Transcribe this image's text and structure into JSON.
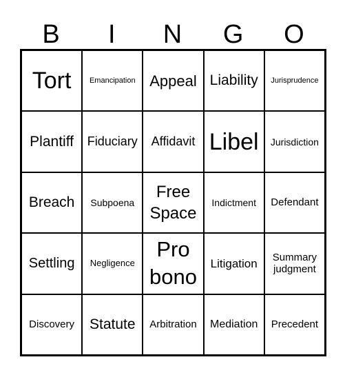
{
  "header": [
    "B",
    "I",
    "N",
    "G",
    "O"
  ],
  "cells": [
    {
      "text": "Tort",
      "size": 34
    },
    {
      "text": "Emancipation",
      "size": 11
    },
    {
      "text": "Appeal",
      "size": 22
    },
    {
      "text": "Liability",
      "size": 21
    },
    {
      "text": "Jurisprudence",
      "size": 11
    },
    {
      "text": "Plantiff",
      "size": 21
    },
    {
      "text": "Fiduciary",
      "size": 18
    },
    {
      "text": "Affidavit",
      "size": 18
    },
    {
      "text": "Libel",
      "size": 34
    },
    {
      "text": "Jurisdiction",
      "size": 14
    },
    {
      "text": "Breach",
      "size": 21
    },
    {
      "text": "Subpoena",
      "size": 14
    },
    {
      "text": "Free Space",
      "size": 24
    },
    {
      "text": "Indictment",
      "size": 14
    },
    {
      "text": "Defendant",
      "size": 15
    },
    {
      "text": "Settling",
      "size": 20
    },
    {
      "text": "Negligence",
      "size": 13
    },
    {
      "text": "Pro bono",
      "size": 31
    },
    {
      "text": "Litigation",
      "size": 17
    },
    {
      "text": "Summary judgment",
      "size": 15
    },
    {
      "text": "Discovery",
      "size": 15
    },
    {
      "text": "Statute",
      "size": 21
    },
    {
      "text": "Arbitration",
      "size": 15
    },
    {
      "text": "Mediation",
      "size": 16
    },
    {
      "text": "Precedent",
      "size": 15
    }
  ]
}
